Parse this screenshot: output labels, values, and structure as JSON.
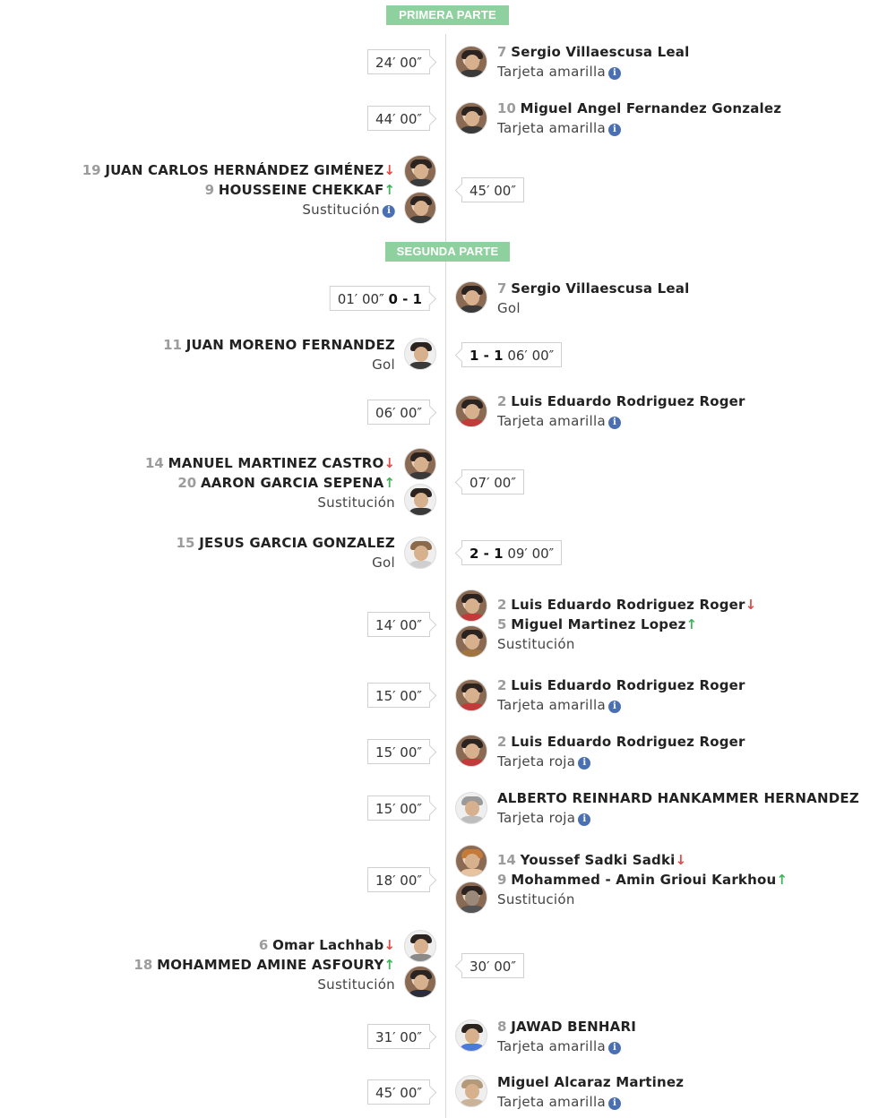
{
  "sections": {
    "first": "PRIMERA PARTE",
    "second": "SEGUNDA PARTE"
  },
  "labels": {
    "yellow": "Tarjeta amarilla",
    "red": "Tarjeta roja",
    "goal": "Gol",
    "sub": "Sustitución",
    "info_glyph": "i",
    "arrow_down": "↓",
    "arrow_up": "↑"
  },
  "events": [
    {
      "time": "24′ 00″",
      "num": "7",
      "name": "Sergio Villaescusa Leal",
      "type": "Tarjeta amarilla"
    },
    {
      "time": "44′ 00″",
      "num": "10",
      "name": "Miguel Angel Fernandez Gonzalez",
      "type": "Tarjeta amarilla"
    },
    {
      "time": "45′ 00″",
      "out_num": "19",
      "out_name": "JUAN CARLOS HERNÁNDEZ GIMÉNEZ",
      "in_num": "9",
      "in_name": "HOUSSEINE CHEKKAF",
      "type": "Sustitución"
    },
    {
      "time": "01′ 00″",
      "score": "0 - 1",
      "num": "7",
      "name": "Sergio Villaescusa Leal",
      "type": "Gol"
    },
    {
      "time": "06′ 00″",
      "score": "1 - 1",
      "num": "11",
      "name": "JUAN MORENO FERNANDEZ",
      "type": "Gol"
    },
    {
      "time": "06′ 00″",
      "num": "2",
      "name": "Luis Eduardo Rodriguez Roger",
      "type": "Tarjeta amarilla"
    },
    {
      "time": "07′ 00″",
      "out_num": "14",
      "out_name": "MANUEL MARTINEZ CASTRO",
      "in_num": "20",
      "in_name": "AARON GARCIA SEPENA",
      "type": "Sustitución"
    },
    {
      "time": "09′ 00″",
      "score": "2 - 1",
      "num": "15",
      "name": "JESUS GARCIA GONZALEZ",
      "type": "Gol"
    },
    {
      "time": "14′ 00″",
      "out_num": "2",
      "out_name": "Luis Eduardo Rodriguez Roger",
      "in_num": "5",
      "in_name": "Miguel Martinez Lopez",
      "type": "Sustitución"
    },
    {
      "time": "15′ 00″",
      "num": "2",
      "name": "Luis Eduardo Rodriguez Roger",
      "type": "Tarjeta amarilla"
    },
    {
      "time": "15′ 00″",
      "num": "2",
      "name": "Luis Eduardo Rodriguez Roger",
      "type": "Tarjeta roja"
    },
    {
      "time": "15′ 00″",
      "name": "ALBERTO REINHARD HANKAMMER HERNANDEZ",
      "type": "Tarjeta roja"
    },
    {
      "time": "18′ 00″",
      "out_num": "14",
      "out_name": "Youssef Sadki Sadki",
      "in_num": "9",
      "in_name": "Mohammed - Amin Grioui Karkhou",
      "type": "Sustitución"
    },
    {
      "time": "30′ 00″",
      "out_num": "6",
      "out_name": "Omar Lachhab",
      "in_num": "18",
      "in_name": "MOHAMMED AMINE ASFOURY",
      "type": "Sustitución"
    },
    {
      "time": "31′ 00″",
      "num": "8",
      "name": "JAWAD BENHARI",
      "type": "Tarjeta amarilla"
    },
    {
      "time": "45′ 00″",
      "name": "Miguel Alcaraz Martinez",
      "type": "Tarjeta amarilla"
    }
  ]
}
